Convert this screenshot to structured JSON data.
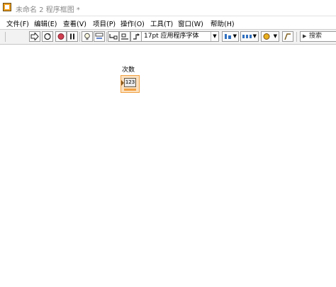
{
  "window": {
    "title": "未命名 2 程序框图 *"
  },
  "menu": [
    "文件(F)",
    "编辑(E)",
    "查看(V)",
    "项目(P)",
    "操作(O)",
    "工具(T)",
    "窗口(W)",
    "帮助(H)"
  ],
  "toolbar": {
    "font": "17pt 应用程序字体",
    "search_placeholder": "搜索"
  },
  "diagram": {
    "control_label": "次数",
    "control_value": "123"
  },
  "colors": {
    "control_border": "#f0a040",
    "control_fill": "#fbe0c0"
  }
}
